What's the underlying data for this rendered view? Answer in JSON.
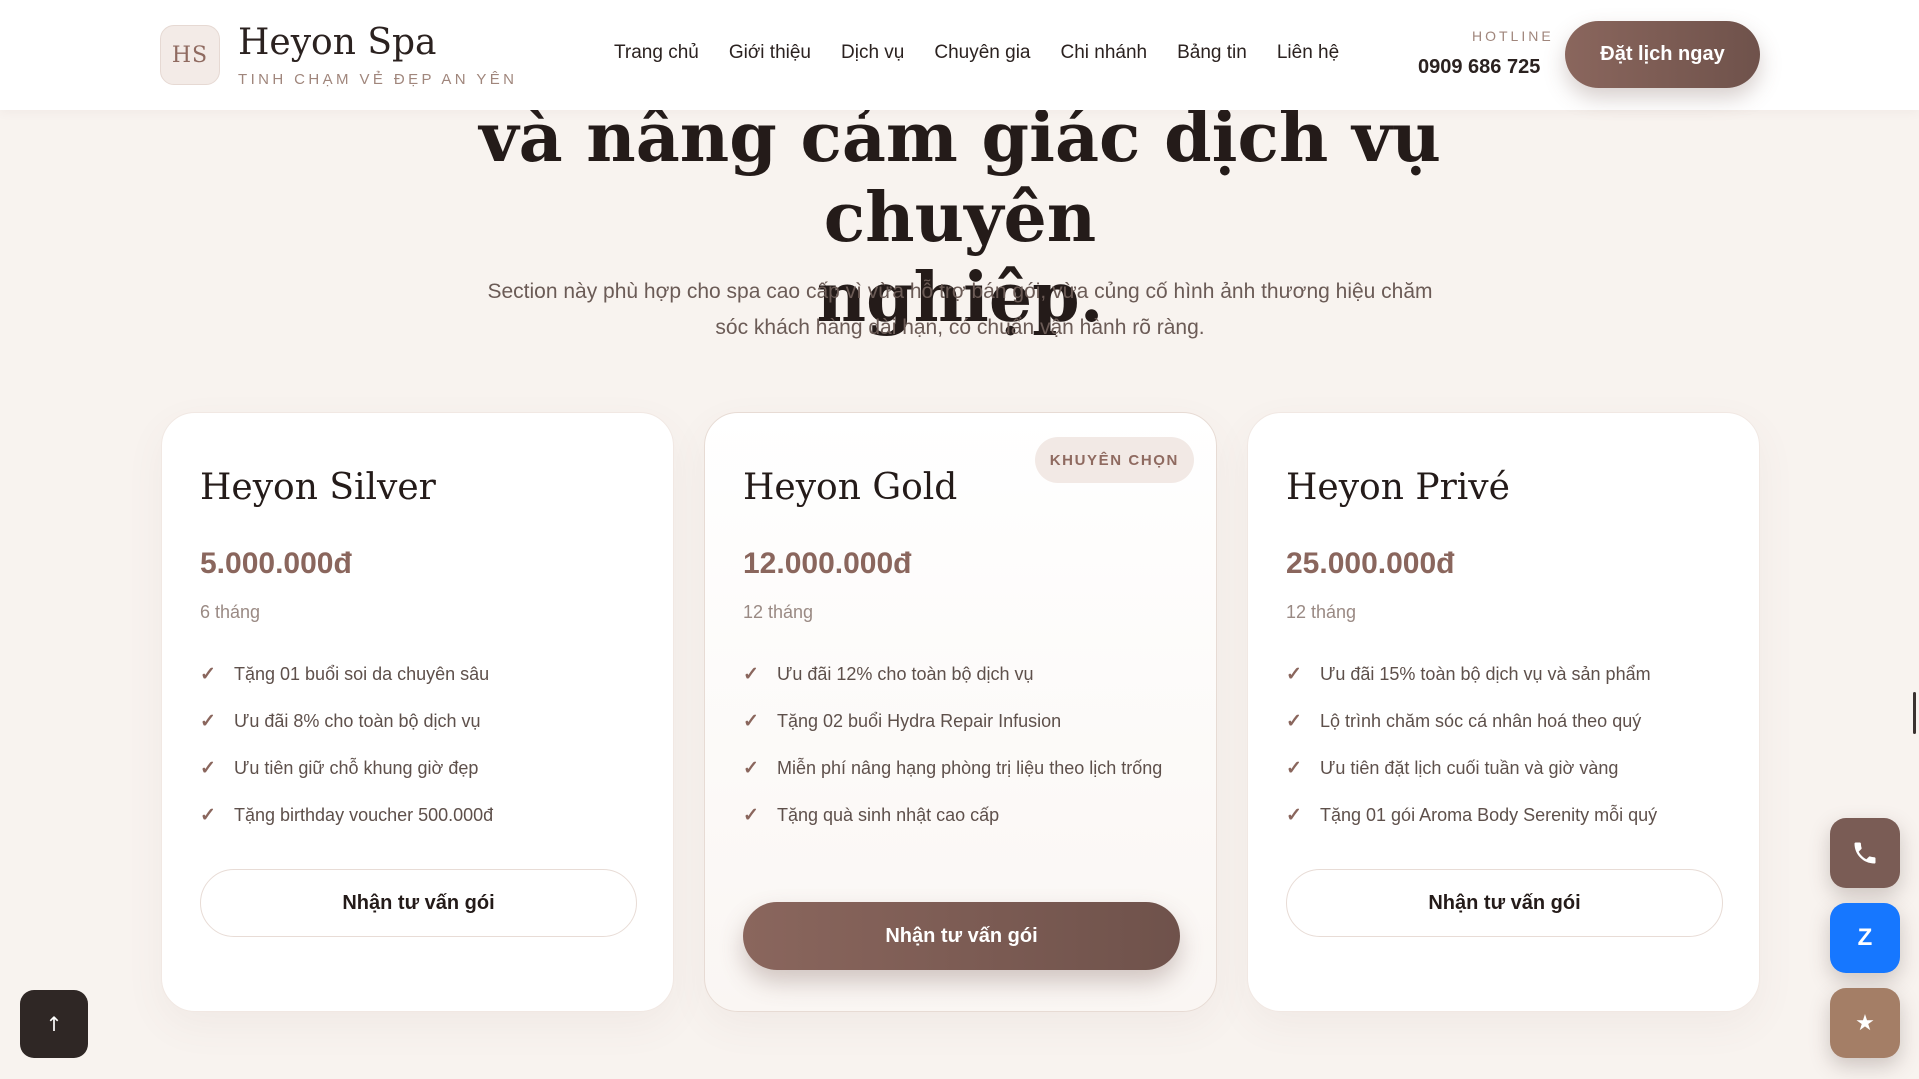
{
  "header": {
    "logo_initials": "HS",
    "brand_name": "Heyon Spa",
    "tagline": "TINH CHẠM VẺ ĐẸP AN YÊN",
    "nav": [
      "Trang chủ",
      "Giới thiệu",
      "Dịch vụ",
      "Chuyên gia",
      "Chi nhánh",
      "Bảng tin",
      "Liên hệ"
    ],
    "hotline_label": "HOTLINE",
    "hotline_number": "0909 686 725",
    "cta_label": "Đặt lịch ngay"
  },
  "hero": {
    "title_line1": "và nâng cảm giác dịch vụ chuyên",
    "title_line2": "nghiệp.",
    "subtitle_line1": "Section này phù hợp cho spa cao cấp vì vừa hỗ trợ bán gói, vừa củng cố hình ảnh thương hiệu chăm",
    "subtitle_line2": "sóc khách hàng dài hạn, có chuẩn vận hành rõ ràng."
  },
  "packages": [
    {
      "name": "Heyon Silver",
      "price": "5.000.000đ",
      "duration": "6 tháng",
      "features": [
        "Tặng 01 buổi soi da chuyên sâu",
        "Ưu đãi 8% cho toàn bộ dịch vụ",
        "Ưu tiên giữ chỗ khung giờ đẹp",
        "Tặng birthday voucher 500.000đ"
      ],
      "button_label": "Nhận tư vấn gói"
    },
    {
      "badge": "KHUYÊN CHỌN",
      "name": "Heyon Gold",
      "price": "12.000.000đ",
      "duration": "12 tháng",
      "features": [
        "Ưu đãi 12% cho toàn bộ dịch vụ",
        "Tặng 02 buổi Hydra Repair Infusion",
        "Miễn phí nâng hạng phòng trị liệu theo lịch trống",
        "Tặng quà sinh nhật cao cấp"
      ],
      "button_label": "Nhận tư vấn gói"
    },
    {
      "name": "Heyon Privé",
      "price": "25.000.000đ",
      "duration": "12 tháng",
      "features": [
        "Ưu đãi 15% toàn bộ dịch vụ và sản phẩm",
        "Lộ trình chăm sóc cá nhân hoá theo quý",
        "Ưu tiên đặt lịch cuối tuần và giờ vàng",
        "Tặng 01 gói Aroma Body Serenity mỗi quý"
      ],
      "button_label": "Nhận tư vấn gói"
    }
  ],
  "floating": {
    "zalo_label": "Z",
    "phone_icon": "phone-icon",
    "star_icon": "star-icon",
    "top_icon": "arrow-up-icon"
  },
  "colors": {
    "accent": "#8a665d",
    "accent_dark": "#6f524b",
    "background": "#f8f3ef",
    "zalo": "#1677ff"
  }
}
